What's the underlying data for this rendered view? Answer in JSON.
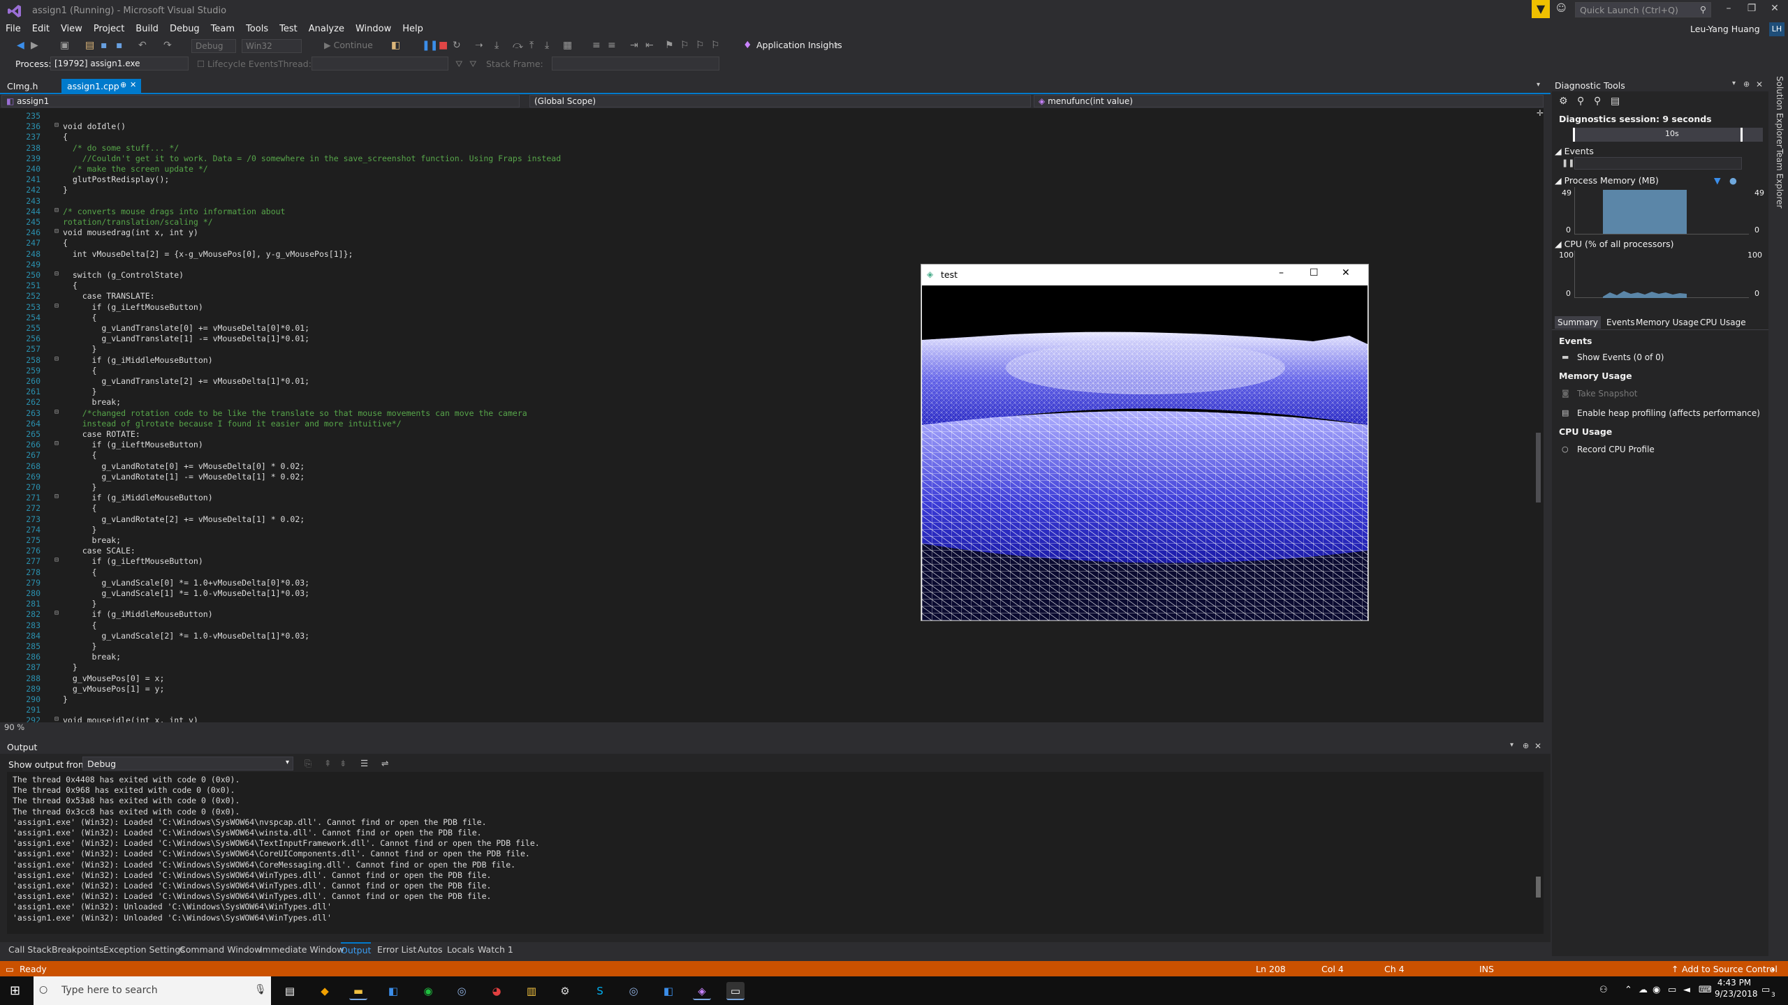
{
  "app": {
    "window_title": "assign1 (Running) - Microsoft Visual Studio",
    "quick_launch_placeholder": "Quick Launch (Ctrl+Q)",
    "user_name": "Leu-Yang Huang",
    "user_initials": "LH"
  },
  "menu": [
    "File",
    "Edit",
    "View",
    "Project",
    "Build",
    "Debug",
    "Team",
    "Tools",
    "Test",
    "Analyze",
    "Window",
    "Help"
  ],
  "toolbar": {
    "config": "Debug",
    "platform": "Win32",
    "continue_label": "Continue",
    "app_insights_label": "Application Insights"
  },
  "debugbar": {
    "process_label": "Process:",
    "process_value": "[19792] assign1.exe",
    "lifecycle_label": "Lifecycle Events",
    "thread_label": "Thread:",
    "stack_frame_label": "Stack Frame:"
  },
  "doc_tabs": [
    {
      "label": "CImg.h",
      "active": false
    },
    {
      "label": "assign1.cpp",
      "active": true
    }
  ],
  "navbar": {
    "project": "assign1",
    "scope": "(Global Scope)",
    "member": "menufunc(int value)"
  },
  "editor": {
    "zoom": "90 %",
    "lines": [
      {
        "n": "235",
        "fold": "",
        "t": ""
      },
      {
        "n": "236",
        "fold": "⊟",
        "t": "void doIdle()"
      },
      {
        "n": "237",
        "fold": "",
        "t": "{"
      },
      {
        "n": "238",
        "fold": "",
        "t": "  /* do some stuff... */"
      },
      {
        "n": "239",
        "fold": "",
        "t": "    //Couldn't get it to work. Data = /0 somewhere in the save_screenshot function. Using Fraps instead"
      },
      {
        "n": "240",
        "fold": "",
        "t": "  /* make the screen update */"
      },
      {
        "n": "241",
        "fold": "",
        "t": "  glutPostRedisplay();"
      },
      {
        "n": "242",
        "fold": "",
        "t": "}"
      },
      {
        "n": "243",
        "fold": "",
        "t": ""
      },
      {
        "n": "244",
        "fold": "⊟",
        "t": "/* converts mouse drags into information about"
      },
      {
        "n": "245",
        "fold": "",
        "t": "rotation/translation/scaling */"
      },
      {
        "n": "246",
        "fold": "⊟",
        "t": "void mousedrag(int x, int y)"
      },
      {
        "n": "247",
        "fold": "",
        "t": "{"
      },
      {
        "n": "248",
        "fold": "",
        "t": "  int vMouseDelta[2] = {x-g_vMousePos[0], y-g_vMousePos[1]};"
      },
      {
        "n": "249",
        "fold": "",
        "t": ""
      },
      {
        "n": "250",
        "fold": "⊟",
        "t": "  switch (g_ControlState)"
      },
      {
        "n": "251",
        "fold": "",
        "t": "  {"
      },
      {
        "n": "252",
        "fold": "",
        "t": "    case TRANSLATE:"
      },
      {
        "n": "253",
        "fold": "⊟",
        "t": "      if (g_iLeftMouseButton)"
      },
      {
        "n": "254",
        "fold": "",
        "t": "      {"
      },
      {
        "n": "255",
        "fold": "",
        "t": "        g_vLandTranslate[0] += vMouseDelta[0]*0.01;"
      },
      {
        "n": "256",
        "fold": "",
        "t": "        g_vLandTranslate[1] -= vMouseDelta[1]*0.01;"
      },
      {
        "n": "257",
        "fold": "",
        "t": "      }"
      },
      {
        "n": "258",
        "fold": "⊟",
        "t": "      if (g_iMiddleMouseButton)"
      },
      {
        "n": "259",
        "fold": "",
        "t": "      {"
      },
      {
        "n": "260",
        "fold": "",
        "t": "        g_vLandTranslate[2] += vMouseDelta[1]*0.01;"
      },
      {
        "n": "261",
        "fold": "",
        "t": "      }"
      },
      {
        "n": "262",
        "fold": "",
        "t": "      break;"
      },
      {
        "n": "263",
        "fold": "⊟",
        "t": "    /*changed rotation code to be like the translate so that mouse movements can move the camera"
      },
      {
        "n": "264",
        "fold": "",
        "t": "    instead of glrotate because I found it easier and more intuitive*/"
      },
      {
        "n": "265",
        "fold": "",
        "t": "    case ROTATE:"
      },
      {
        "n": "266",
        "fold": "⊟",
        "t": "      if (g_iLeftMouseButton)"
      },
      {
        "n": "267",
        "fold": "",
        "t": "      {"
      },
      {
        "n": "268",
        "fold": "",
        "t": "        g_vLandRotate[0] += vMouseDelta[0] * 0.02;"
      },
      {
        "n": "269",
        "fold": "",
        "t": "        g_vLandRotate[1] -= vMouseDelta[1] * 0.02;"
      },
      {
        "n": "270",
        "fold": "",
        "t": "      }"
      },
      {
        "n": "271",
        "fold": "⊟",
        "t": "      if (g_iMiddleMouseButton)"
      },
      {
        "n": "272",
        "fold": "",
        "t": "      {"
      },
      {
        "n": "273",
        "fold": "",
        "t": "        g_vLandRotate[2] += vMouseDelta[1] * 0.02;"
      },
      {
        "n": "274",
        "fold": "",
        "t": "      }"
      },
      {
        "n": "275",
        "fold": "",
        "t": "      break;"
      },
      {
        "n": "276",
        "fold": "",
        "t": "    case SCALE:"
      },
      {
        "n": "277",
        "fold": "⊟",
        "t": "      if (g_iLeftMouseButton)"
      },
      {
        "n": "278",
        "fold": "",
        "t": "      {"
      },
      {
        "n": "279",
        "fold": "",
        "t": "        g_vLandScale[0] *= 1.0+vMouseDelta[0]*0.03;"
      },
      {
        "n": "280",
        "fold": "",
        "t": "        g_vLandScale[1] *= 1.0-vMouseDelta[1]*0.03;"
      },
      {
        "n": "281",
        "fold": "",
        "t": "      }"
      },
      {
        "n": "282",
        "fold": "⊟",
        "t": "      if (g_iMiddleMouseButton)"
      },
      {
        "n": "283",
        "fold": "",
        "t": "      {"
      },
      {
        "n": "284",
        "fold": "",
        "t": "        g_vLandScale[2] *= 1.0-vMouseDelta[1]*0.03;"
      },
      {
        "n": "285",
        "fold": "",
        "t": "      }"
      },
      {
        "n": "286",
        "fold": "",
        "t": "      break;"
      },
      {
        "n": "287",
        "fold": "",
        "t": "  }"
      },
      {
        "n": "288",
        "fold": "",
        "t": "  g_vMousePos[0] = x;"
      },
      {
        "n": "289",
        "fold": "",
        "t": "  g_vMousePos[1] = y;"
      },
      {
        "n": "290",
        "fold": "",
        "t": "}"
      },
      {
        "n": "291",
        "fold": "",
        "t": ""
      },
      {
        "n": "292",
        "fold": "⊟",
        "t": "void mouseidle(int x, int y)"
      }
    ]
  },
  "test_window": {
    "title": "test",
    "min": "–",
    "max": "☐",
    "close": "✕"
  },
  "output": {
    "title": "Output",
    "show_from_label": "Show output from:",
    "show_from_value": "Debug",
    "lines": [
      "The thread 0x4408 has exited with code 0 (0x0).",
      "The thread 0x968 has exited with code 0 (0x0).",
      "The thread 0x53a8 has exited with code 0 (0x0).",
      "The thread 0x3cc8 has exited with code 0 (0x0).",
      "'assign1.exe' (Win32): Loaded 'C:\\Windows\\SysWOW64\\nvspcap.dll'. Cannot find or open the PDB file.",
      "'assign1.exe' (Win32): Loaded 'C:\\Windows\\SysWOW64\\winsta.dll'. Cannot find or open the PDB file.",
      "'assign1.exe' (Win32): Loaded 'C:\\Windows\\SysWOW64\\TextInputFramework.dll'. Cannot find or open the PDB file.",
      "'assign1.exe' (Win32): Loaded 'C:\\Windows\\SysWOW64\\CoreUIComponents.dll'. Cannot find or open the PDB file.",
      "'assign1.exe' (Win32): Loaded 'C:\\Windows\\SysWOW64\\CoreMessaging.dll'. Cannot find or open the PDB file.",
      "'assign1.exe' (Win32): Loaded 'C:\\Windows\\SysWOW64\\WinTypes.dll'. Cannot find or open the PDB file.",
      "'assign1.exe' (Win32): Loaded 'C:\\Windows\\SysWOW64\\WinTypes.dll'. Cannot find or open the PDB file.",
      "'assign1.exe' (Win32): Loaded 'C:\\Windows\\SysWOW64\\WinTypes.dll'. Cannot find or open the PDB file.",
      "'assign1.exe' (Win32): Unloaded 'C:\\Windows\\SysWOW64\\WinTypes.dll'",
      "'assign1.exe' (Win32): Unloaded 'C:\\Windows\\SysWOW64\\WinTypes.dll'"
    ]
  },
  "bottom_tabs": [
    "Call Stack",
    "Breakpoints",
    "Exception Settings",
    "Command Window",
    "Immediate Window",
    "Output",
    "Error List",
    "Autos",
    "Locals",
    "Watch 1"
  ],
  "bottom_tab_active": "Output",
  "diagnostics": {
    "title": "Diagnostic Tools",
    "session": "Diagnostics session: 9 seconds",
    "timeline_tick": "10s",
    "events_label": "Events",
    "process_memory_label": "Process Memory (MB)",
    "mem_max": "49",
    "mem_min": "0",
    "cpu_label": "CPU (% of all processors)",
    "cpu_max": "100",
    "cpu_min": "0",
    "tabs": [
      "Summary",
      "Events",
      "Memory Usage",
      "CPU Usage"
    ],
    "events_section": "Events",
    "show_events": "Show Events (0 of 0)",
    "memory_section": "Memory Usage",
    "take_snapshot": "Take Snapshot",
    "heap_profiling": "Enable heap profiling (affects performance)",
    "cpu_section": "CPU Usage",
    "record_cpu": "Record CPU Profile"
  },
  "side_tabs": [
    "Solution Explorer",
    "Team Explorer"
  ],
  "status": {
    "ready": "Ready",
    "ln": "Ln 208",
    "col": "Col 4",
    "ch": "Ch 4",
    "ins": "INS",
    "source_control": "Add to Source Control"
  },
  "taskbar": {
    "search_placeholder": "Type here to search",
    "time": "4:43 PM",
    "date": "9/23/2018",
    "notif_count": "3"
  },
  "colors": {
    "accent": "#007acc",
    "statusbar": "#ca5100",
    "editor_bg": "#1e1e1e",
    "chrome_bg": "#2d2d30"
  }
}
